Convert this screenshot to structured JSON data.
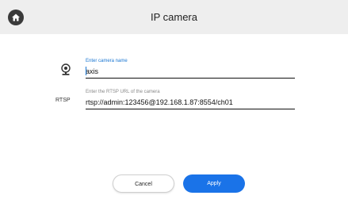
{
  "header": {
    "title": "IP camera",
    "home_icon": "home-icon"
  },
  "form": {
    "name_field": {
      "label": "Enter camera name",
      "value": "axis",
      "icon": "webcam-icon",
      "label_color": "#1976d2"
    },
    "url_field": {
      "label": "Enter the RTSP URL of the camera",
      "value": "rtsp://admin:123456@192.168.1.87:8554/ch01",
      "side_label": "RTSP"
    }
  },
  "buttons": {
    "cancel_label": "Cancel",
    "apply_label": "Apply",
    "apply_color": "#1a73e8"
  }
}
